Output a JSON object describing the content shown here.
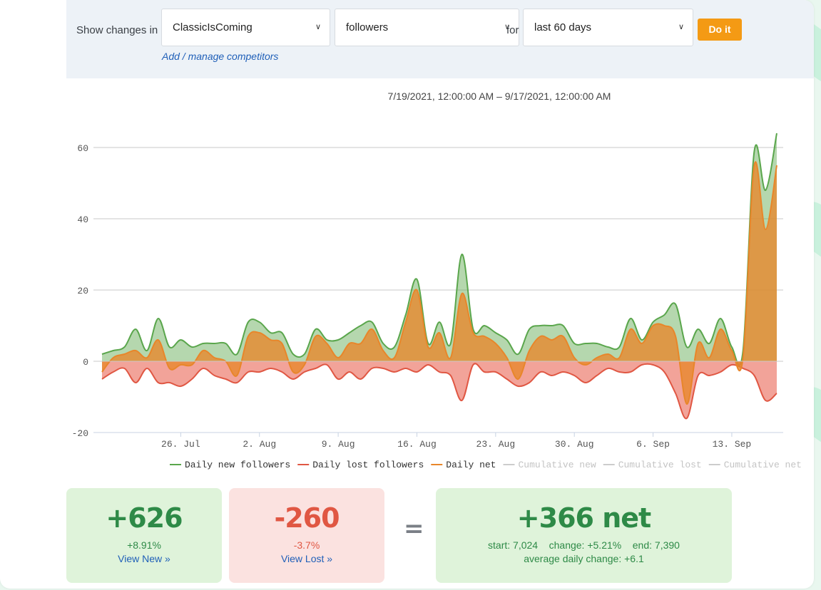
{
  "controls": {
    "show_label": "Show changes in",
    "account": "ClassicIsComing",
    "metric": "followers",
    "for_label": "for",
    "period": "last 60 days",
    "do_it": "Do it",
    "manage_link": "Add / manage competitors"
  },
  "date_range": "7/19/2021, 12:00:00 AM – 9/17/2021, 12:00:00 AM",
  "chart_data": {
    "type": "area",
    "title": "",
    "ylim": [
      -20,
      60
    ],
    "yticks": [
      "60",
      "40",
      "20",
      "0",
      "-20"
    ],
    "xticks": [
      "26. Jul",
      "2. Aug",
      "9. Aug",
      "16. Aug",
      "23. Aug",
      "30. Aug",
      "6. Sep",
      "13. Sep"
    ],
    "x": [
      "7/19",
      "7/20",
      "7/21",
      "7/22",
      "7/23",
      "7/24",
      "7/25",
      "7/26",
      "7/27",
      "7/28",
      "7/29",
      "7/30",
      "7/31",
      "8/1",
      "8/2",
      "8/3",
      "8/4",
      "8/5",
      "8/6",
      "8/7",
      "8/8",
      "8/9",
      "8/10",
      "8/11",
      "8/12",
      "8/13",
      "8/14",
      "8/15",
      "8/16",
      "8/17",
      "8/18",
      "8/19",
      "8/20",
      "8/21",
      "8/22",
      "8/23",
      "8/24",
      "8/25",
      "8/26",
      "8/27",
      "8/28",
      "8/29",
      "8/30",
      "8/31",
      "9/1",
      "9/2",
      "9/3",
      "9/4",
      "9/5",
      "9/6",
      "9/7",
      "9/8",
      "9/9",
      "9/10",
      "9/11",
      "9/12",
      "9/13",
      "9/14",
      "9/15",
      "9/16",
      "9/17"
    ],
    "series": [
      {
        "name": "Daily new followers",
        "color": "#5aa64c",
        "values": [
          2,
          3,
          4,
          9,
          3,
          12,
          4,
          6,
          4,
          5,
          5,
          5,
          2,
          11,
          11,
          8,
          8,
          2,
          2,
          9,
          6,
          6,
          8,
          10,
          11,
          5,
          4,
          13,
          23,
          5,
          11,
          5,
          30,
          9,
          10,
          8,
          6,
          2,
          9,
          10,
          10,
          10,
          5,
          5,
          5,
          4,
          4,
          12,
          6,
          11,
          13,
          16,
          4,
          9,
          5,
          12,
          4,
          3,
          59,
          48,
          64
        ]
      },
      {
        "name": "Daily lost followers",
        "color": "#e05743",
        "values": [
          -5,
          -3,
          -2,
          -6,
          -2,
          -6,
          -6,
          -7,
          -5,
          -2,
          -4,
          -5,
          -6,
          -3,
          -3,
          -2,
          -3,
          -5,
          -3,
          -2,
          -1,
          -5,
          -3,
          -5,
          -2,
          -2,
          -3,
          -2,
          -3,
          -1,
          -3,
          -4,
          -11,
          -1,
          -3,
          -3,
          -5,
          -7,
          -6,
          -3,
          -4,
          -3,
          -4,
          -6,
          -4,
          -2,
          -3,
          -3,
          -1,
          -1,
          -3,
          -9,
          -16,
          -4,
          -4,
          -3,
          -1,
          -2,
          -4,
          -11,
          -9
        ]
      },
      {
        "name": "Daily net",
        "color": "#e8862a",
        "values": [
          -3,
          1,
          2,
          3,
          1,
          6,
          -2,
          -1,
          -1,
          3,
          1,
          0,
          -4,
          7,
          8,
          6,
          5,
          -3,
          -1,
          7,
          5,
          1,
          5,
          5,
          9,
          3,
          1,
          11,
          20,
          4,
          8,
          1,
          19,
          8,
          7,
          5,
          1,
          -5,
          3,
          7,
          6,
          7,
          1,
          -1,
          1,
          2,
          1,
          9,
          5,
          10,
          10,
          7,
          -12,
          5,
          1,
          9,
          3,
          1,
          55,
          37,
          55
        ]
      }
    ],
    "legend": [
      {
        "name": "Daily new followers",
        "color": "#5aa64c",
        "active": true
      },
      {
        "name": "Daily lost followers",
        "color": "#e05743",
        "active": true
      },
      {
        "name": "Daily net",
        "color": "#e8862a",
        "active": true
      },
      {
        "name": "Cumulative new",
        "color": "#cccccc",
        "active": false
      },
      {
        "name": "Cumulative lost",
        "color": "#cccccc",
        "active": false
      },
      {
        "name": "Cumulative net",
        "color": "#cccccc",
        "active": false
      }
    ],
    "legend_position": "bottom",
    "grid": true
  },
  "summary": {
    "new": {
      "value": "+626",
      "pct": "+8.91%",
      "link": "View New »"
    },
    "lost": {
      "value": "-260",
      "pct": "-3.7%",
      "link": "View Lost »"
    },
    "equals": "=",
    "net": {
      "value": "+366 net",
      "stats": "start: 7,024    change: +5.21%    end: 7,390",
      "avg": "average daily change: +6.1"
    }
  },
  "colors": {
    "green_box": "#dff3da",
    "red_box": "#fbe2e0",
    "green_text": "#2e8a47",
    "red_text": "#e05743",
    "accent": "#f49a14",
    "link": "#1f5fb8"
  }
}
